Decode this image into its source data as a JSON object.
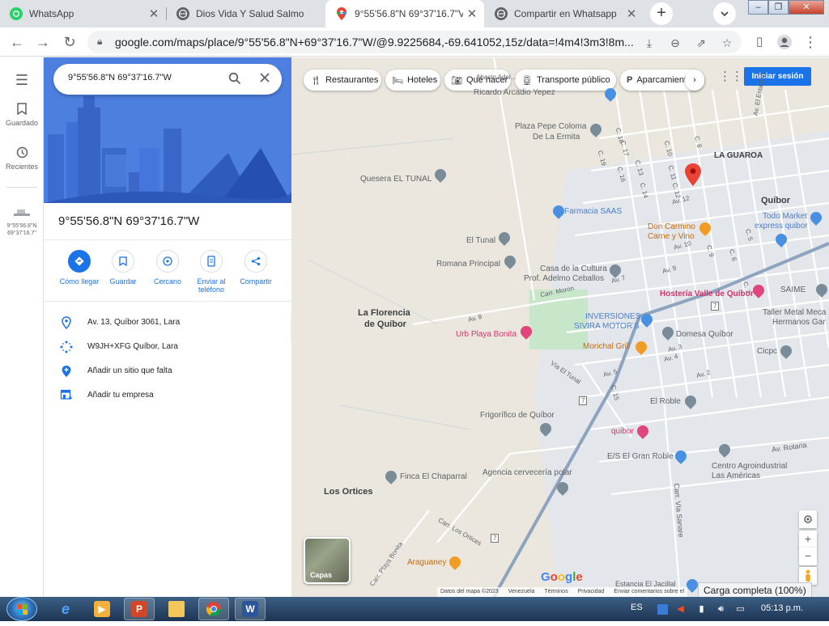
{
  "browser": {
    "tabs": [
      {
        "title": "WhatsApp",
        "icon": "whatsapp-icon",
        "active": false
      },
      {
        "title": "Dios Vida Y Salud Salmo",
        "icon": "globe-icon",
        "active": false
      },
      {
        "title": "9°55'56.8\"N 69°37'16.7\"V",
        "icon": "google-maps-icon",
        "active": true
      },
      {
        "title": "Compartir en Whatsapp",
        "icon": "globe-icon",
        "active": false
      }
    ],
    "new_tab_label": "+",
    "url": "google.com/maps/place/9°55'56.8\"N+69°37'16.7\"W/@9.9225684,-69.641052,15z/data=!4m4!3m3!8m..."
  },
  "rail": {
    "items": [
      {
        "label": "Guardado",
        "icon": "bookmark-icon"
      },
      {
        "label": "Recientes",
        "icon": "history-icon"
      }
    ],
    "recent_place": "9°55'56.8\"N 69°37'16.7\""
  },
  "panel": {
    "search_value": "9°55'56.8\"N 69°37'16.7\"W",
    "title": "9°55'56.8\"N 69°37'16.7\"W",
    "actions": [
      {
        "label": "Cómo llegar",
        "icon": "directions-icon"
      },
      {
        "label": "Guardar",
        "icon": "bookmark-icon"
      },
      {
        "label": "Cercano",
        "icon": "nearby-icon"
      },
      {
        "label": "Enviar al teléfono",
        "icon": "send-to-phone-icon"
      },
      {
        "label": "Compartir",
        "icon": "share-icon"
      }
    ],
    "info": [
      {
        "text": "Av. 13, Quíbor 3061, Lara",
        "icon": "location-pin-icon"
      },
      {
        "text": "W9JH+XFG Quíbor, Lara",
        "icon": "plus-code-icon"
      },
      {
        "text": "Añadir un sitio que falta",
        "icon": "add-place-icon"
      },
      {
        "text": "Añadir tu empresa",
        "icon": "add-business-icon"
      }
    ]
  },
  "map": {
    "chips": [
      {
        "label": "Restaurantes",
        "icon": "restaurant-icon"
      },
      {
        "label": "Hoteles",
        "icon": "hotel-icon"
      },
      {
        "label": "Qué hacer",
        "icon": "camera-icon"
      },
      {
        "label": "Transporte público",
        "icon": "transit-icon"
      },
      {
        "label": "Aparcamiento",
        "icon": "parking-icon"
      }
    ],
    "signin_label": "Iniciar sesión",
    "labels": {
      "ricardo": "Ricardo Arcadio Yepez",
      "plaza": "Plaza Pepe Coloma",
      "ermita": "De La Ermita",
      "quesera": "Quesera EL TUNAL",
      "guaroa": "LA GUAROA",
      "quibor": "Quíbor",
      "farmacia": "Farmacia SAAS",
      "todomarket1": "Todo Market",
      "todomarket2": "express quibor",
      "doncarmino1": "Don Carmino",
      "doncarmino2": "Carne y Vino",
      "eltunal": "El Tunal",
      "romana": "Romana Principal",
      "casacultura1": "Casa de la Cultura",
      "casacultura2": "Prof. Adelmo Ceballos",
      "hosteria": "Hostería Valle de Quíbor",
      "saime": "SAIME",
      "tallermetal1": "Taller Metal Meca",
      "tallermetal2": "Hermanos Gar",
      "laflorencia1": "La Florencia",
      "laflorencia2": "de Quíbor",
      "urb": "Urb Playa Bonita",
      "inversiones1": "INVERSIONES",
      "inversiones2": "SIVIRA MOTOR'S",
      "domesa": "Domesa Quíbor",
      "morichal": "Morichal Grill",
      "cicpc": "Cicpc",
      "elroble": "El Roble",
      "frigorifico": "Frigorífico de Quíbor",
      "quibor_pink": "quibor",
      "es": "E/S El Gran Roble",
      "centro1": "Centro Agroindustrial",
      "centro2": "Las Américas",
      "finca": "Finca El Chaparral",
      "agencia": "Agencia cervecería polar",
      "losortices": "Los Ortices",
      "araguaney": "Araguaney",
      "estancia": "Estancia El Jacillal",
      "av_rotaria": "Av. Rotaria",
      "carr_via_sanare": "Carr. Vía Sanare",
      "via_el_tunal": "Vía El Tunal",
      "carr_los_ortices": "Carr. Los Ortices",
      "carr_playa_bonita": "Carr. Playa Bonita",
      "carr_moron": "Carr. Moron",
      "av_el_estadium": "Av. El Estadium",
      "av_12": "Av. 12",
      "av_10": "Av. 10",
      "av_9": "Av. 9",
      "av_7": "Av. 7",
      "av_8": "Av. 8",
      "av_5": "Av. 5",
      "av_4": "Av. 4",
      "av_3": "Av. 3",
      "av_2": "Av. 2",
      "c5": "C. 5",
      "c6": "C. 6",
      "c7": "C. 7",
      "c8": "C. 8",
      "c9": "C. 9",
      "c10": "C. 10",
      "c11": "C. 11",
      "c12": "C. 12",
      "c13": "C. 13",
      "c14": "C. 14",
      "c15": "C. 15",
      "c16": "C. 16",
      "c17": "C. 17",
      "c18": "C. 18",
      "c19": "C. 19",
      "r7": "7",
      "r7b": "7",
      "r7c": "7",
      "tooltip": "Abasto Adel..."
    },
    "layers_label": "Capas",
    "google": "Google",
    "footer": [
      "Datos del mapa ©2023",
      "Venezuela",
      "Términos",
      "Privacidad",
      "Enviar comentarios sobre el"
    ],
    "status": "Carga completa (100%)"
  },
  "taskbar": {
    "language": "ES",
    "clock": "05:13 p.m."
  },
  "colors": {
    "accent": "#1a73e8",
    "map_bg": "#ebe7de",
    "road": "#ffffff",
    "highway": "#8ea3bd",
    "park": "#c8e6c9",
    "red_pin": "#ea4335"
  }
}
